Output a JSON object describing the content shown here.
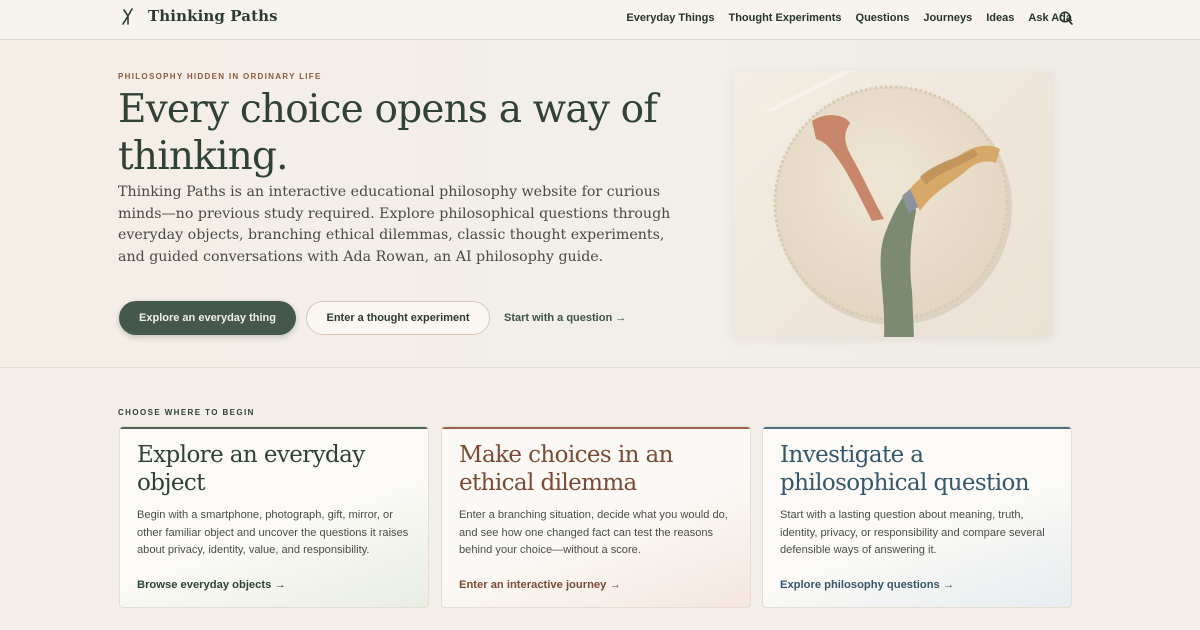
{
  "header": {
    "brand": "Thinking Paths",
    "nav": [
      "Everyday Things",
      "Thought Experiments",
      "Questions",
      "Journeys",
      "Ideas",
      "Ask Ada"
    ]
  },
  "hero": {
    "eyebrow": "PHILOSOPHY HIDDEN IN ORDINARY LIFE",
    "headline": "Every choice opens a way of thinking.",
    "intro": "Thinking Paths is an interactive educational philosophy website for curious minds—no previous study required. Explore philosophical questions through everyday objects, branching ethical dilemmas, classic thought experiments, and guided conversations with Ada Rowan, an AI philosophy guide.",
    "primary_button": "Explore an everyday thing",
    "secondary_button": "Enter a thought experiment",
    "link": "Start with a question →"
  },
  "section": {
    "label": "CHOOSE WHERE TO BEGIN",
    "cards": [
      {
        "title": "Explore an everyday object",
        "body": "Begin with a smartphone, photograph, gift, mirror, or other familiar object and uncover the questions it raises about privacy, identity, value, and responsibility.",
        "link": "Browse everyday objects →"
      },
      {
        "title": "Make choices in an ethical dilemma",
        "body": "Enter a branching situation, decide what you would do, and see how one changed fact can test the reasons behind your choice—without a score.",
        "link": "Enter an interactive journey →"
      },
      {
        "title": "Investigate a philosophical question",
        "body": "Start with a lasting question about meaning, truth, identity, privacy, or responsibility and compare several defensible ways of answering it.",
        "link": "Explore philosophy questions →"
      }
    ]
  },
  "icons": {
    "logo": "branching-path-icon",
    "search": "search-icon"
  },
  "colors": {
    "primary": "#44594a",
    "accent_rust": "#9a6248",
    "accent_blue": "#4f6f82",
    "background": "#f3efe8"
  }
}
